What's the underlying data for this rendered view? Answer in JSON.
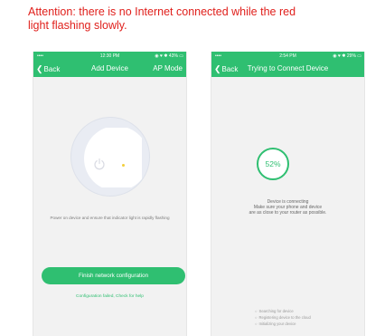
{
  "caption": {
    "line1": "Attention: there is no Internet connected while the red",
    "line2": "light flashing slowly."
  },
  "colors": {
    "accent": "#2fbf71",
    "warning_text": "#e0201c",
    "indicator": "#f2cf3c"
  },
  "screen1": {
    "status": {
      "signal": "•••• ",
      "time": "12:30 PM",
      "right": "◉ ♥ ✱ 43% ▭"
    },
    "nav": {
      "back_label": "Back",
      "title": "Add Device",
      "right_label": "AP Mode"
    },
    "instruction": "Power on device and ensure  that indicator light is rapidly flashing",
    "finish_button": "Finish network configuration",
    "failed_link": "Configuration failed,  Check for help"
  },
  "screen2": {
    "status": {
      "signal": "•••• ",
      "time": "2:54 PM",
      "right": "◉ ♥ ✱ 29% ▭"
    },
    "nav": {
      "back_label": "Back",
      "title": "Trying to Connect Device"
    },
    "progress": "52%",
    "message": {
      "line1": "Device is connecting",
      "line2": "Make sure your phone and device",
      "line3": "are as close to your router as possible."
    },
    "steps": [
      "Searching for device",
      "Registering device to the cloud",
      "Initializing your device"
    ]
  }
}
